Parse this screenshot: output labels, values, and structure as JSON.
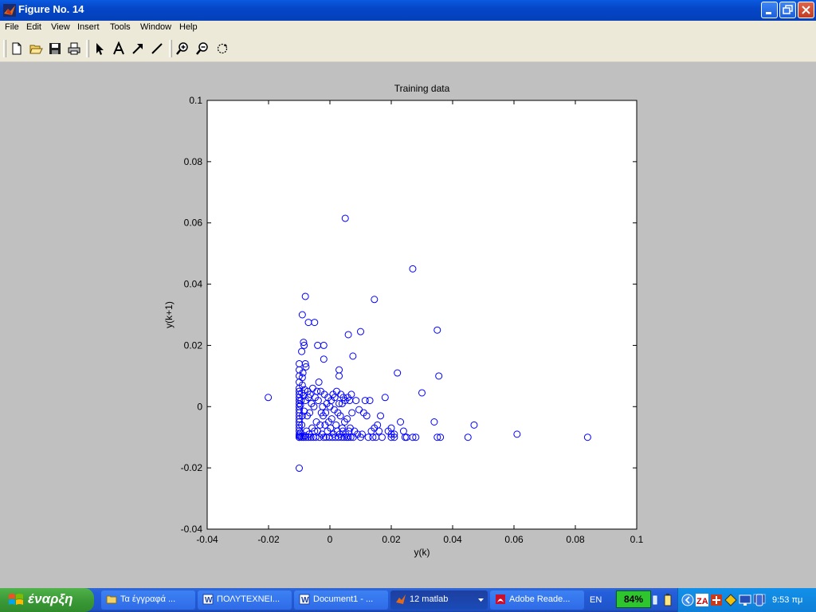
{
  "window": {
    "title": "Figure No. 14",
    "buttons": [
      "minimize-button",
      "restore-button",
      "close-button"
    ]
  },
  "menu": {
    "items": [
      "File",
      "Edit",
      "View",
      "Insert",
      "Tools",
      "Window",
      "Help"
    ]
  },
  "toolbar": {
    "buttons": [
      "new-figure-icon",
      "open-icon",
      "save-icon",
      "print-icon",
      "edit-plot-arrow-icon",
      "insert-text-icon",
      "insert-arrow-icon",
      "insert-line-icon",
      "zoom-in-icon",
      "zoom-out-icon",
      "rotate-3d-icon"
    ]
  },
  "chart_data": {
    "type": "scatter",
    "title": "Training data",
    "xlabel": "y(k)",
    "ylabel": "y(k+1)",
    "xlim": [
      -0.04,
      0.1
    ],
    "ylim": [
      -0.04,
      0.1
    ],
    "xticks": [
      "-0.04",
      "-0.02",
      "0",
      "0.02",
      "0.04",
      "0.06",
      "0.08",
      "0.1"
    ],
    "yticks": [
      "-0.04",
      "-0.02",
      "0",
      "0.02",
      "0.04",
      "0.06",
      "0.08",
      "0.1"
    ],
    "marker": "o",
    "color": "#0000ff",
    "grid": false,
    "x": [
      -0.0201,
      -0.01,
      -0.01,
      -0.01,
      -0.01,
      -0.01,
      -0.01,
      -0.01,
      -0.01,
      -0.01,
      -0.01,
      -0.01,
      -0.01,
      -0.01,
      -0.01,
      -0.01,
      -0.01,
      -0.01,
      -0.01,
      -0.01,
      -0.01,
      -0.01,
      -0.01,
      -0.01,
      -0.0096,
      -0.0096,
      -0.0096,
      -0.0094,
      -0.0092,
      -0.0092,
      -0.0092,
      -0.009,
      -0.009,
      -0.009,
      -0.0088,
      -0.0086,
      -0.0086,
      -0.0086,
      -0.0084,
      -0.0084,
      -0.0082,
      -0.0082,
      -0.008,
      -0.008,
      -0.0078,
      -0.0078,
      -0.0076,
      -0.0074,
      -0.0072,
      -0.007,
      -0.007,
      -0.0068,
      -0.0066,
      -0.0064,
      -0.0062,
      -0.006,
      -0.0058,
      -0.0056,
      -0.0054,
      -0.0052,
      -0.005,
      -0.0048,
      -0.0046,
      -0.0044,
      -0.0042,
      -0.004,
      -0.0038,
      -0.0036,
      -0.0034,
      -0.0032,
      -0.003,
      -0.0028,
      -0.0026,
      -0.0024,
      -0.0022,
      -0.002,
      -0.0018,
      -0.0016,
      -0.0014,
      -0.0012,
      -0.001,
      -0.0008,
      -0.0006,
      -0.0004,
      -0.0002,
      0.0,
      0.0002,
      0.0004,
      0.0006,
      0.0008,
      0.001,
      0.0012,
      0.0014,
      0.0016,
      0.0018,
      0.002,
      0.0022,
      0.0024,
      0.0026,
      0.0028,
      0.003,
      0.003,
      0.0032,
      0.0034,
      0.0036,
      0.0038,
      0.004,
      0.004,
      0.0042,
      0.0044,
      0.0046,
      0.0048,
      0.005,
      0.0052,
      0.0054,
      0.0056,
      0.0058,
      0.006,
      0.0062,
      0.0064,
      0.0066,
      0.0068,
      0.007,
      0.0072,
      0.0076,
      0.008,
      0.0085,
      0.009,
      0.0095,
      0.01,
      0.0105,
      0.011,
      0.0115,
      0.012,
      0.0125,
      0.013,
      0.0135,
      0.014,
      0.0145,
      0.015,
      0.0155,
      0.016,
      0.0165,
      0.017,
      0.018,
      0.019,
      0.02,
      0.02,
      0.02,
      0.021,
      0.021,
      0.022,
      0.023,
      0.024,
      0.0245,
      0.025,
      0.027,
      0.028,
      0.03,
      0.034,
      0.035,
      0.0355,
      0.036,
      0.045,
      0.047,
      0.061,
      0.084,
      -0.01,
      -0.0092,
      -0.009,
      -0.008,
      -0.007,
      -0.005,
      -0.004,
      -0.002,
      -0.002,
      0.003,
      0.005,
      0.006,
      0.0075,
      0.01,
      0.0145,
      0.027,
      0.035
    ],
    "y": [
      0.003,
      -0.0201,
      -0.01,
      -0.0095,
      -0.009,
      -0.008,
      -0.007,
      -0.006,
      -0.005,
      -0.004,
      -0.003,
      -0.002,
      -0.001,
      0.0,
      0.001,
      0.002,
      0.003,
      0.004,
      0.005,
      0.006,
      0.008,
      0.01,
      0.012,
      0.014,
      -0.0098,
      -0.0085,
      0.0005,
      0.002,
      -0.01,
      -0.006,
      0.0045,
      -0.003,
      0.007,
      0.0095,
      0.011,
      -0.01,
      0.0035,
      0.021,
      -0.0015,
      0.02,
      -0.0095,
      0.0055,
      0.002,
      0.014,
      -0.01,
      0.013,
      -0.008,
      -0.003,
      0.005,
      -0.01,
      0.003,
      -0.009,
      -0.002,
      0.004,
      -0.01,
      0.001,
      -0.007,
      0.006,
      -0.01,
      0.0,
      -0.008,
      0.003,
      -0.01,
      -0.005,
      0.005,
      -0.008,
      0.002,
      0.008,
      -0.01,
      -0.006,
      0.005,
      -0.002,
      -0.009,
      0.0,
      -0.003,
      -0.01,
      0.004,
      -0.006,
      -0.002,
      -0.01,
      0.001,
      -0.008,
      0.003,
      -0.005,
      -0.01,
      0.0,
      -0.007,
      0.002,
      -0.004,
      -0.01,
      0.004,
      -0.009,
      -0.001,
      0.003,
      -0.01,
      -0.006,
      0.005,
      -0.008,
      -0.002,
      -0.01,
      0.001,
      0.012,
      -0.009,
      -0.003,
      0.004,
      -0.01,
      -0.007,
      0.001,
      -0.008,
      0.003,
      -0.01,
      -0.005,
      0.002,
      -0.009,
      -0.01,
      -0.004,
      0.003,
      -0.01,
      -0.008,
      0.002,
      -0.007,
      -0.01,
      0.004,
      -0.002,
      -0.01,
      -0.008,
      0.002,
      -0.009,
      -0.001,
      -0.01,
      -0.009,
      -0.002,
      0.002,
      -0.003,
      -0.01,
      0.002,
      -0.008,
      -0.01,
      -0.007,
      -0.01,
      -0.006,
      -0.008,
      -0.003,
      -0.01,
      0.003,
      -0.008,
      -0.009,
      -0.01,
      -0.007,
      -0.009,
      -0.01,
      0.011,
      -0.005,
      -0.008,
      -0.01,
      -0.01,
      -0.01,
      -0.01,
      0.0045,
      -0.005,
      -0.01,
      0.01,
      -0.01,
      -0.01,
      -0.006,
      -0.009,
      -0.01,
      -0.01,
      0.018,
      0.03,
      0.036,
      0.0275,
      0.0275,
      0.02,
      0.0155,
      0.02,
      0.01,
      0.0615,
      0.0235,
      0.0165,
      0.0245,
      0.035,
      0.045,
      0.025,
      0.01
    ]
  },
  "taskbar": {
    "start_label": "έναρξη",
    "tasks": [
      {
        "label": "Τα έγγραφά ...",
        "icon": "folder-icon"
      },
      {
        "label": "ΠΟΛΥΤΕΧΝΕΙ...",
        "icon": "word-icon"
      },
      {
        "label": "Document1 - ...",
        "icon": "word-icon"
      },
      {
        "label": "12 matlab",
        "icon": "matlab-icon"
      },
      {
        "label": "Adobe Reade...",
        "icon": "adobe-reader-icon"
      }
    ],
    "language": "EN",
    "battery_label": "84%",
    "clock": "9:53 πμ"
  }
}
